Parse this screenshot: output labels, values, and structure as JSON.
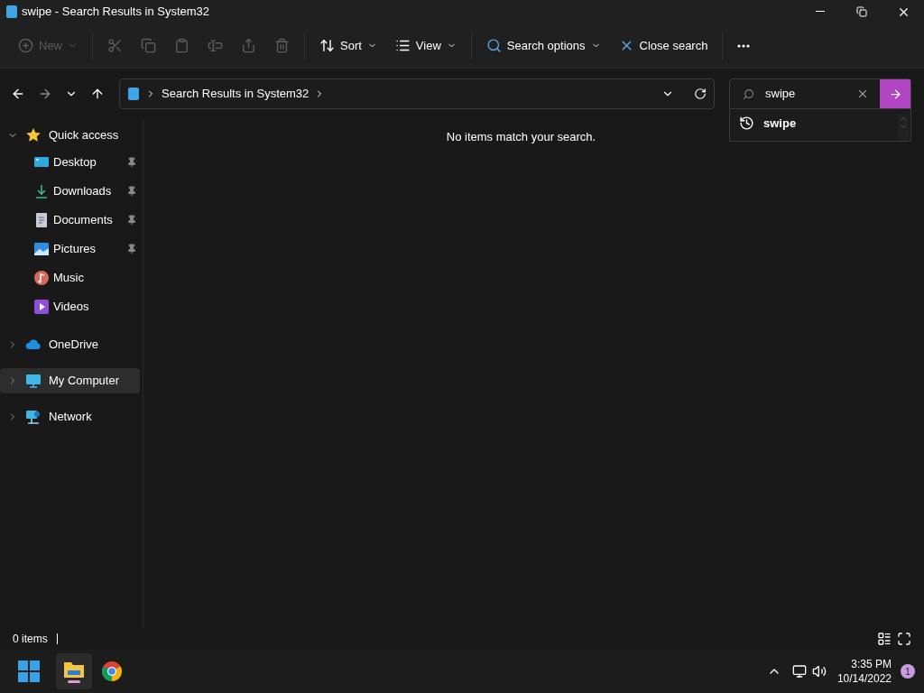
{
  "window": {
    "title": "swipe - Search Results in System32"
  },
  "toolbar": [
    {
      "label": "New",
      "disabled": true,
      "menu": true
    },
    {
      "disabled": true
    },
    {
      "disabled": true
    },
    {
      "disabled": true
    },
    {
      "disabled": true
    },
    {
      "disabled": true
    },
    {
      "disabled": true
    },
    {
      "label": "Sort",
      "disabled": false,
      "menu": true
    },
    {
      "label": "View",
      "disabled": false,
      "menu": true
    },
    {
      "label": "Search options",
      "disabled": false,
      "menu": true
    },
    {
      "label": "Close search",
      "disabled": false,
      "menu": false
    },
    {
      "disabled": false
    }
  ],
  "address": {
    "path": "Search Results in System32"
  },
  "search": {
    "value": "swipe",
    "suggestions": [
      "swipe"
    ]
  },
  "sidebar": [
    {
      "label": "Quick access",
      "expanded": true,
      "selected": false,
      "children": [
        {
          "label": "Desktop",
          "pinned": true
        },
        {
          "label": "Downloads",
          "pinned": true
        },
        {
          "label": "Documents",
          "pinned": true
        },
        {
          "label": "Pictures",
          "pinned": true
        },
        {
          "label": "Music",
          "pinned": false
        },
        {
          "label": "Videos",
          "pinned": false
        }
      ]
    },
    {
      "label": "OneDrive",
      "expanded": false,
      "selected": false
    },
    {
      "label": "My Computer",
      "expanded": false,
      "selected": true
    },
    {
      "label": "Network",
      "expanded": false,
      "selected": false
    }
  ],
  "content": {
    "message": "No items match your search."
  },
  "status_bar": {
    "count": "0 items"
  },
  "taskbar": {
    "time": "3:35 PM",
    "date": "10/14/2022",
    "notifications": "1"
  }
}
